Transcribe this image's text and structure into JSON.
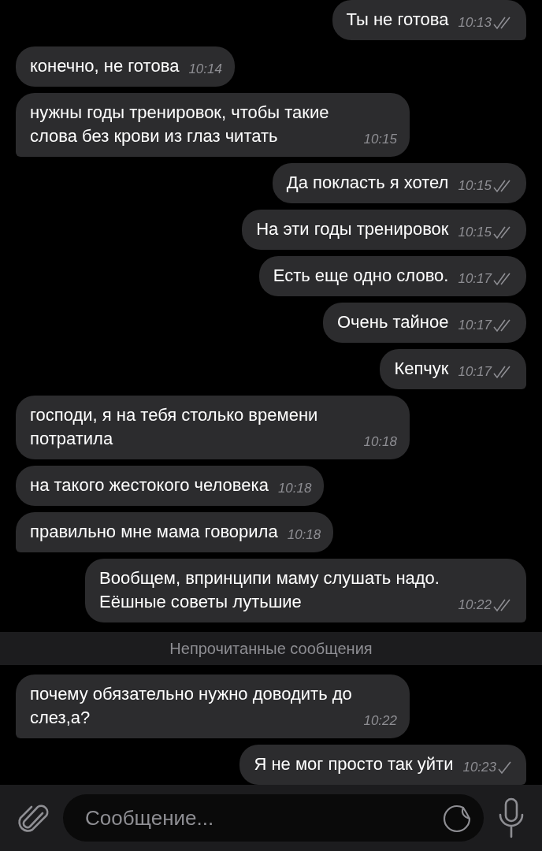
{
  "messages": [
    {
      "outgoing": true,
      "text": "Ты не готова",
      "time": "10:13",
      "read": true,
      "tail": true
    },
    {
      "outgoing": false,
      "text": "конечно, не готова",
      "time": "10:14",
      "tail": false
    },
    {
      "outgoing": false,
      "text": "нужны годы тренировок, чтобы такие слова без крови из глаз читать",
      "time": "10:15",
      "tail": true
    },
    {
      "outgoing": true,
      "text": "Да покласть я хотел",
      "time": "10:15",
      "read": true,
      "tail": false
    },
    {
      "outgoing": true,
      "text": "На эти годы тренировок",
      "time": "10:15",
      "read": true,
      "tail": false
    },
    {
      "outgoing": true,
      "text": "Есть еще одно слово.",
      "time": "10:17",
      "read": true,
      "tail": false
    },
    {
      "outgoing": true,
      "text": "Очень тайное",
      "time": "10:17",
      "read": true,
      "tail": false
    },
    {
      "outgoing": true,
      "text": "Кепчук",
      "time": "10:17",
      "read": true,
      "tail": true
    },
    {
      "outgoing": false,
      "text": "господи, я на тебя столько времени потратила",
      "time": "10:18",
      "tail": false
    },
    {
      "outgoing": false,
      "text": "на такого жестокого человека",
      "time": "10:18",
      "tail": false
    },
    {
      "outgoing": false,
      "text": "правильно мне мама говорила",
      "time": "10:18",
      "tail": true
    },
    {
      "outgoing": true,
      "text": "Вообщем, впринципи маму слушать надо. Еёшные советы лутьшие",
      "time": "10:22",
      "read": true,
      "tail": true
    },
    {
      "kind": "divider",
      "text": "Непрочитанные сообщения"
    },
    {
      "outgoing": false,
      "text": "почему обязательно нужно доводить до слез,а?",
      "time": "10:22",
      "tail": true
    },
    {
      "outgoing": true,
      "text": "Я не мог просто так уйти",
      "time": "10:23",
      "read": false,
      "tail": true
    }
  ],
  "composer": {
    "placeholder": "Сообщение..."
  }
}
